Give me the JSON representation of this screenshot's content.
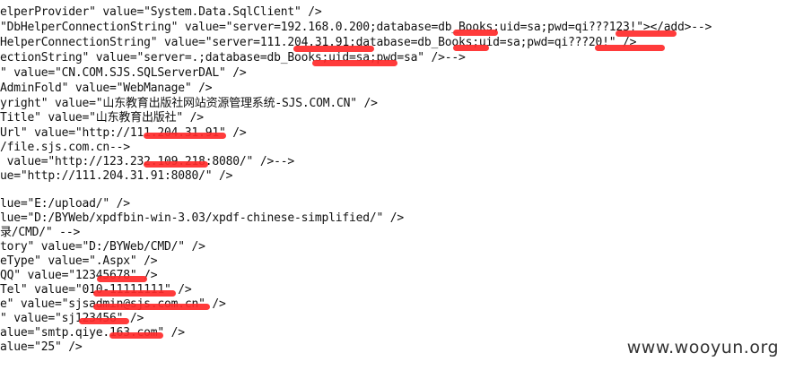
{
  "colors": {
    "background": "#ffffff",
    "text": "#111111",
    "redaction": "#ff2a2a",
    "watermark": "#333333"
  },
  "lines": [
    "elperProvider\" value=\"System.Data.SqlClient\" />",
    "\"DbHelperConnectionString\" value=\"server=192.168.0.200;database=db_Books;uid=sa;pwd=qi???123!\"></add>-->",
    "HelperConnectionString\" value=\"server=111.204.31.91;database=db_Books;uid=sa;pwd=qi???20!\" />",
    "ectionString\" value=\"server=.;database=db_Books;uid=sa;pwd=sa\" />-->",
    "\" value=\"CN.COM.SJS.SQLServerDAL\" />",
    "AdminFold\" value=\"WebManage\" />",
    "yright\" value=\"山东教育出版社网站资源管理系统-SJS.COM.CN\" />",
    "Title\" value=\"山东教育出版社\" />",
    "Url\" value=\"http://111.204.31.91\" />",
    "/file.sjs.com.cn-->",
    " value=\"http://123.232.109.218:8080/\" />-->",
    "ue=\"http://111.204.31.91:8080/\" />",
    "",
    "lue=\"E:/upload/\" />",
    "lue=\"D:/BYWeb/xpdfbin-win-3.03/xpdf-chinese-simplified/\" />",
    "录/CMD/\" -->",
    "tory\" value=\"D:/BYWeb/CMD/\" />",
    "eType\" value=\".Aspx\" />",
    "QQ\" value=\"12345678\" />",
    "Tel\" value=\"010-11111111\" />",
    "e\" value=\"sjsadmin@sjs.com.cn\" />",
    "\" value=\"sj123456\" />",
    "alue=\"smtp.qiye.163.com\" />",
    "alue=\"25\" />"
  ],
  "watermark": "www.wooyun.org"
}
